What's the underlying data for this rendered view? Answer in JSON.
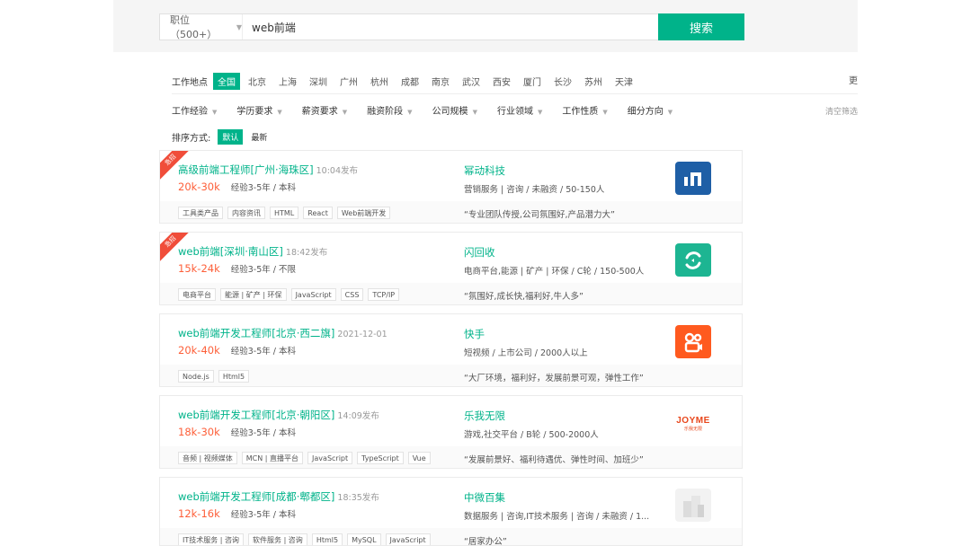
{
  "search": {
    "type_label": "职位（500+）",
    "query": "web前端",
    "button_label": "搜索"
  },
  "filters": {
    "city_label": "工作地点",
    "cities": [
      "全国",
      "北京",
      "上海",
      "深圳",
      "广州",
      "杭州",
      "成都",
      "南京",
      "武汉",
      "西安",
      "厦门",
      "长沙",
      "苏州",
      "天津"
    ],
    "active_city": "全国",
    "truncated_right": "更",
    "dropdowns": [
      "工作经验",
      "学历要求",
      "薪资要求",
      "融资阶段",
      "公司规模",
      "行业领域",
      "工作性质",
      "细分方向"
    ],
    "clear_label": "清空筛选",
    "sort_label": "排序方式:",
    "sort_options": [
      "默认",
      "最新"
    ]
  },
  "jobs": [
    {
      "urgent_label": "急招",
      "title": "高级前端工程师[广州·海珠区]",
      "time": "10:04发布",
      "salary": "20k-30k",
      "requirements": "经验3-5年 / 本科",
      "company": "幂动科技",
      "company_info": "营销服务 | 咨询 / 未融资 / 50-150人",
      "tags": [
        "工具类产品",
        "内容资讯",
        "HTML",
        "React",
        "Web前端开发"
      ],
      "slogan": "“专业团队传授,公司氛围好,产品潜力大”",
      "logo_color": "#1f5fa6"
    },
    {
      "urgent_label": "急招",
      "title": "web前端[深圳·南山区]",
      "time": "18:42发布",
      "salary": "15k-24k",
      "requirements": "经验3-5年 / 不限",
      "company": "闪回收",
      "company_info": "电商平台,能源 | 矿产 | 环保 / C轮 / 150-500人",
      "tags": [
        "电商平台",
        "能源 | 矿产 | 环保",
        "JavaScript",
        "CSS",
        "TCP/IP"
      ],
      "slogan": "“氛围好,成长快,福利好,牛人多”",
      "logo_color": "#1db592"
    },
    {
      "urgent_label": "",
      "title": "web前端开发工程师[北京·西二旗]",
      "time": "2021-12-01",
      "salary": "20k-40k",
      "requirements": "经验3-5年 / 本科",
      "company": "快手",
      "company_info": "短视频 / 上市公司 / 2000人以上",
      "tags": [
        "Node.js",
        "Html5"
      ],
      "slogan": "“大厂环境，福利好，发展前景可观，弹性工作”",
      "logo_color": "#ff5a1f"
    },
    {
      "urgent_label": "",
      "title": "web前端开发工程师[北京·朝阳区]",
      "time": "14:09发布",
      "salary": "18k-30k",
      "requirements": "经验3-5年 / 本科",
      "company": "乐我无限",
      "company_info": "游戏,社交平台 / B轮 / 500-2000人",
      "tags": [
        "音频 | 视频媒体",
        "MCN | 直播平台",
        "JavaScript",
        "TypeScript",
        "Vue"
      ],
      "slogan": "“发展前景好、福利待遇优、弹性时间、加班少”",
      "logo_text": "JOYME",
      "logo_sub": "乐我无限",
      "logo_color": "#e8471c"
    },
    {
      "urgent_label": "",
      "title": "web前端开发工程师[成都·郫都区]",
      "time": "18:35发布",
      "salary": "12k-16k",
      "requirements": "经验3-5年 / 本科",
      "company": "中微百集",
      "company_info": "数据服务 | 咨询,IT技术服务 | 咨询 / 未融资 / 1...",
      "tags": [
        "IT技术服务 | 咨询",
        "软件服务 | 咨询",
        "Html5",
        "MySQL",
        "JavaScript"
      ],
      "slogan": "“居家办公”",
      "logo_color": "#e4e4e4"
    }
  ]
}
